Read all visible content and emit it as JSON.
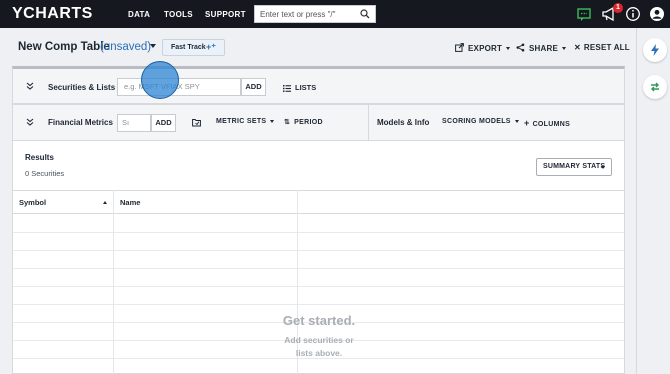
{
  "topbar": {
    "logo_main": "CHARTS",
    "logo_y": "Y",
    "nav": [
      "DATA",
      "TOOLS",
      "SUPPORT"
    ],
    "search_placeholder": "Enter text or press \"/\"",
    "notification_count": "1",
    "icons": [
      "chat-icon",
      "megaphone-icon",
      "info-icon",
      "user-icon"
    ]
  },
  "header": {
    "title": "New Comp Table",
    "status": "(unsaved)",
    "fast_track": "Fast Track",
    "actions": [
      "EXPORT",
      "SHARE",
      "RESET ALL"
    ]
  },
  "securities": {
    "label": "Securities & Lists",
    "placeholder": "e.g. MSFT VFIAX SPY",
    "add": "ADD",
    "lists": "LISTS"
  },
  "metrics": {
    "label": "Financial Metrics",
    "placeholder": "Sı",
    "add": "ADD",
    "metric_sets": "METRIC SETS",
    "period": "PERIOD",
    "models_label": "Models & Info",
    "scoring_models": "SCORING MODELS",
    "columns": "COLUMNS"
  },
  "results": {
    "title": "Results",
    "count": "0 Securities",
    "summary_stats": "SUMMARY STATS",
    "columns": [
      "Symbol",
      "Name"
    ],
    "empty_title": "Get started.",
    "empty_line1": "Add securities or",
    "empty_line2": "lists above."
  },
  "colors": {
    "accent_blue": "#2d6fb5",
    "topbar_bg": "#15191f",
    "badge_red": "#e0242b",
    "sidebar_icon_blue": "#2d6fb5",
    "sidebar_icon_green": "#2e9a57"
  }
}
